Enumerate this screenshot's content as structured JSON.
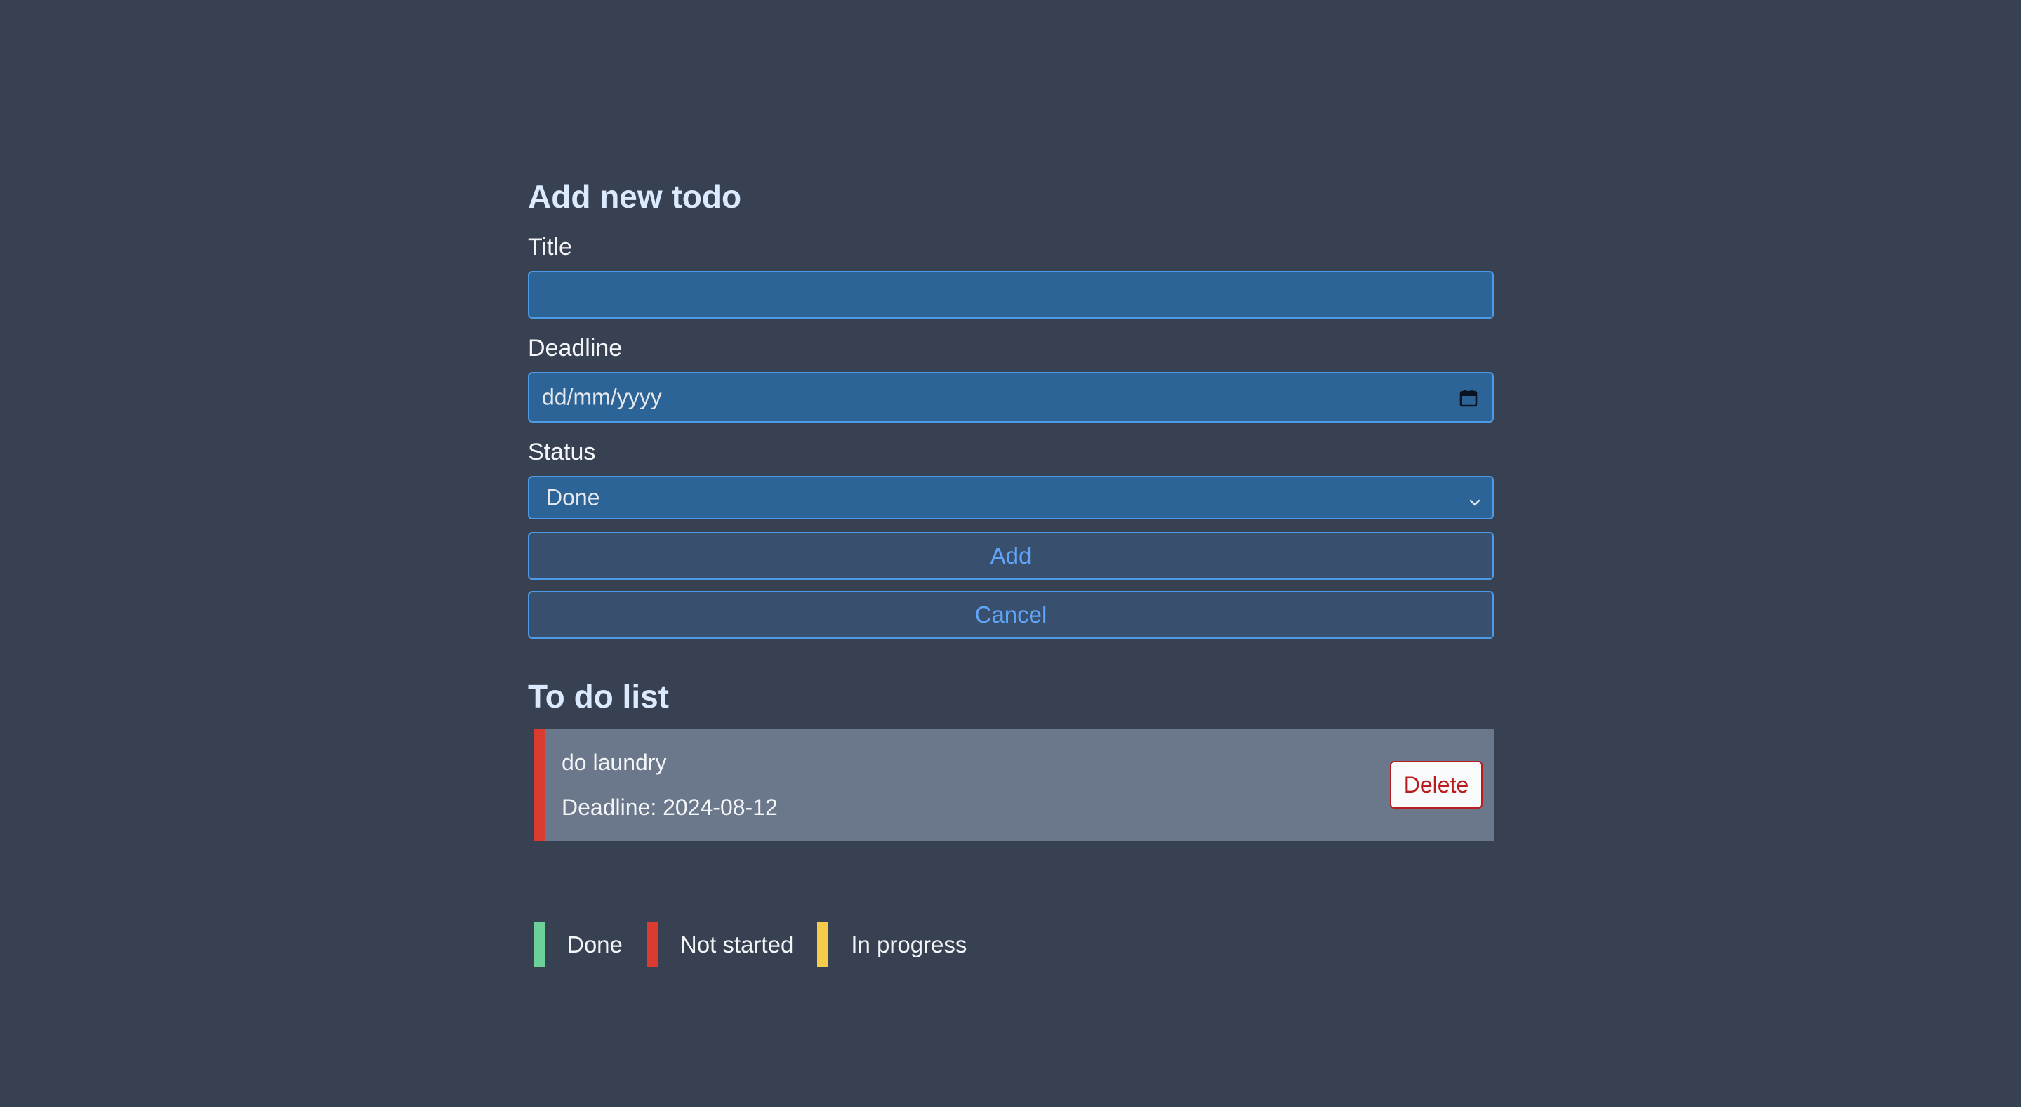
{
  "form": {
    "heading": "Add new todo",
    "title_label": "Title",
    "title_value": "",
    "deadline_label": "Deadline",
    "deadline_placeholder": "dd/mm/yyyy",
    "status_label": "Status",
    "status_selected": "Done",
    "add_label": "Add",
    "cancel_label": "Cancel"
  },
  "list": {
    "heading": "To do list",
    "items": [
      {
        "title": "do laundry",
        "deadline": "Deadline: 2024-08-12",
        "status": "Not started",
        "status_color": "#dc3b2f",
        "delete_label": "Delete"
      }
    ]
  },
  "legend": {
    "items": [
      {
        "label": "Done",
        "color": "#6cd09a"
      },
      {
        "label": "Not started",
        "color": "#dc3b2f"
      },
      {
        "label": "In progress",
        "color": "#f2cc4a"
      }
    ]
  },
  "icons": {
    "calendar": "calendar-icon",
    "chevron": "chevron-down-icon"
  },
  "colors": {
    "background": "#374151",
    "input_bg": "#2c6497",
    "accent": "#4d9be6",
    "button_text": "#60a5fa",
    "item_bg": "#6b778b",
    "danger": "#b91c1c"
  }
}
